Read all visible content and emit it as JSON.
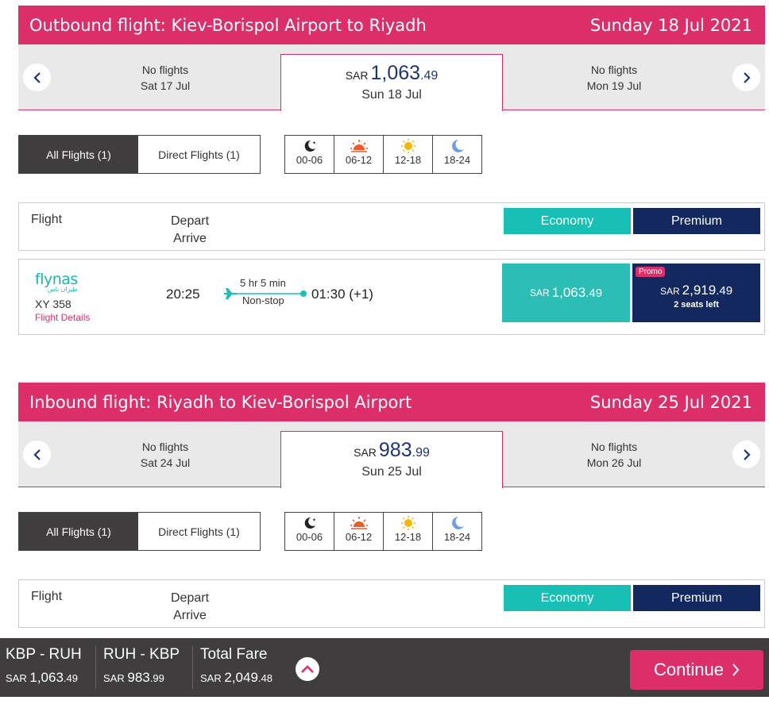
{
  "outbound": {
    "title": "Outbound flight: Kiev-Borispol Airport to Riyadh",
    "date": "Sunday 18 Jul 2021",
    "prev_day": {
      "status": "No flights",
      "day": "Sat 17 Jul"
    },
    "selected_day": {
      "currency": "SAR",
      "price_int": "1,063",
      "price_dec": ".49",
      "day": "Sun 18 Jul"
    },
    "next_day": {
      "status": "No flights",
      "day": "Mon 19 Jul"
    },
    "tabs": {
      "all": "All Flights (1)",
      "direct": "Direct Flights (1)"
    },
    "time_slots": [
      "00-06",
      "06-12",
      "12-18",
      "18-24"
    ],
    "table_header": {
      "flight": "Flight",
      "depart": "Depart",
      "arrive": "Arrive",
      "economy": "Economy",
      "premium": "Premium"
    },
    "flight": {
      "airline_logo": "flynas",
      "airline_logo_sub": "طيران ناس",
      "number": "XY 358",
      "details_link": "Flight Details",
      "depart_time": "20:25",
      "duration": "5 hr 5 min",
      "stops": "Non-stop",
      "arrive_time": "01:30 (+1)",
      "economy_currency": "SAR",
      "economy_int": "1,063",
      "economy_dec": ".49",
      "premium_badge": "Promo",
      "premium_currency": "SAR",
      "premium_int": "2,919",
      "premium_dec": ".49",
      "premium_seats": "2 seats left"
    }
  },
  "inbound": {
    "title": "Inbound flight: Riyadh to Kiev-Borispol Airport",
    "date": "Sunday 25 Jul 2021",
    "prev_day": {
      "status": "No flights",
      "day": "Sat 24 Jul"
    },
    "selected_day": {
      "currency": "SAR",
      "price_int": "983",
      "price_dec": ".99",
      "day": "Sun 25 Jul"
    },
    "next_day": {
      "status": "No flights",
      "day": "Mon 26 Jul"
    },
    "tabs": {
      "all": "All Flights (1)",
      "direct": "Direct Flights (1)"
    },
    "time_slots": [
      "00-06",
      "06-12",
      "12-18",
      "18-24"
    ],
    "table_header": {
      "flight": "Flight",
      "depart": "Depart",
      "arrive": "Arrive",
      "economy": "Economy",
      "premium": "Premium"
    }
  },
  "summary": {
    "outbound": {
      "label": "KBP - RUH",
      "currency": "SAR",
      "price_int": "1,063",
      "price_dec": ".49"
    },
    "inbound": {
      "label": "RUH - KBP",
      "currency": "SAR",
      "price_int": "983",
      "price_dec": ".99"
    },
    "total": {
      "label": "Total Fare",
      "currency": "SAR",
      "price_int": "2,049",
      "price_dec": ".48"
    },
    "continue_label": "Continue"
  },
  "colors": {
    "brand_pink": "#dc2f6a",
    "economy_teal": "#17bfb4",
    "premium_navy": "#12285e",
    "dark_bar": "#3f3d3e"
  },
  "icons": [
    "chevron-left-icon",
    "chevron-right-icon",
    "moon-star-icon",
    "sunrise-icon",
    "sun-icon",
    "crescent-moon-icon",
    "plane-icon",
    "chevron-up-icon"
  ]
}
